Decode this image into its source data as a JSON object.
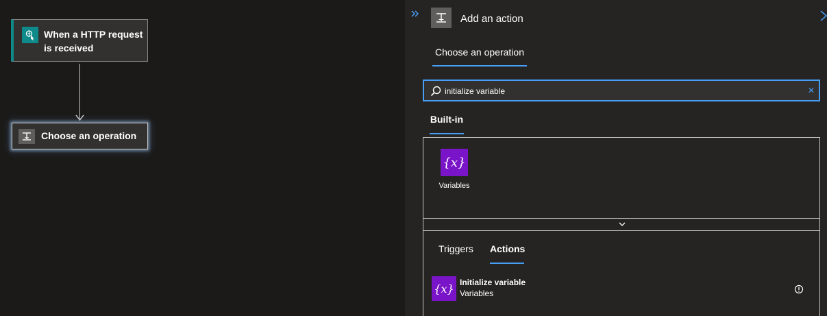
{
  "canvas": {
    "trigger_card": {
      "title": "When a HTTP request is received",
      "icon": "http-request-icon",
      "accent_color": "#0e8a8a"
    },
    "operation_card": {
      "title": "Choose an operation",
      "icon": "operation-icon"
    }
  },
  "panel": {
    "collapse_icon": "double-chevron-right-icon",
    "title": "Add an action",
    "close_icon": "close-icon",
    "operation_tab": "Choose an operation",
    "search": {
      "value": "initialize variable",
      "placeholder": ""
    },
    "builtin_tab": "Built-in",
    "connectors": [
      {
        "label": "Variables",
        "icon": "variables-icon",
        "glyph": "{x}",
        "color": "#7a14c8"
      }
    ],
    "result_tabs": {
      "triggers": "Triggers",
      "actions": "Actions",
      "selected": "Actions"
    },
    "results": [
      {
        "title": "Initialize variable",
        "subtitle": "Variables",
        "icon": "variables-icon",
        "glyph": "{x}"
      }
    ]
  },
  "colors": {
    "accent": "#479ef5",
    "background": "#1b1a19",
    "panel": "#252423",
    "card": "#323130",
    "variables": "#7a14c8"
  }
}
